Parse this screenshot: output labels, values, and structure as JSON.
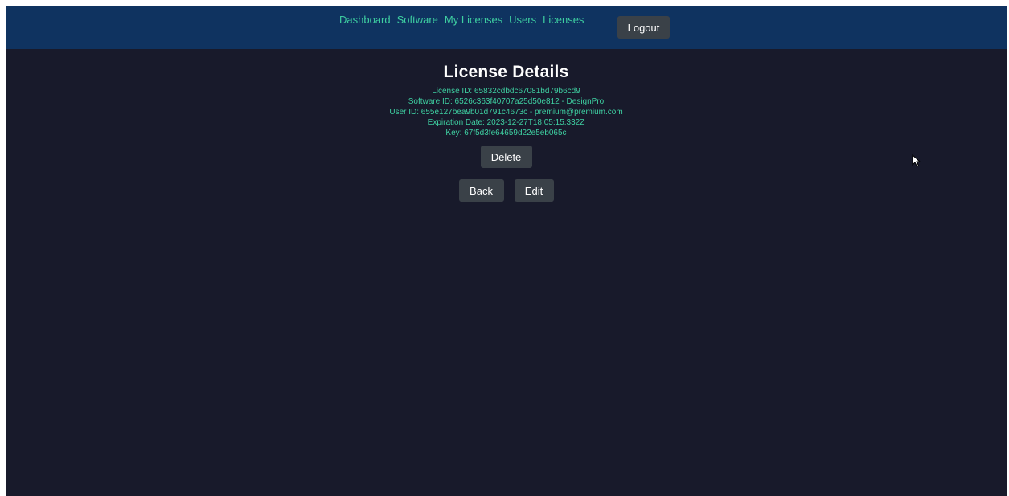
{
  "nav": {
    "links": [
      "Dashboard",
      "Software",
      "My Licenses",
      "Users",
      "Licenses"
    ],
    "logout_label": "Logout"
  },
  "main": {
    "title": "License Details",
    "license_id": "License ID: 65832cdbdc67081bd79b6cd9",
    "software_id": "Software ID: 6526c363f40707a25d50e812 - DesignPro",
    "user_id": "User ID: 655e127bea9b01d791c4673c - premium@premium.com",
    "expiration": "Expiration Date: 2023-12-27T18:05:15.332Z",
    "key": "Key: 67f5d3fe64659d22e5eb065c",
    "delete_label": "Delete",
    "back_label": "Back",
    "edit_label": "Edit"
  },
  "colors": {
    "background": "#181a2b",
    "navbar": "#0f3360",
    "accent_text": "#3ecfa1",
    "button": "#3a4148"
  },
  "icons": {
    "cursor": "mouse-pointer-icon"
  }
}
